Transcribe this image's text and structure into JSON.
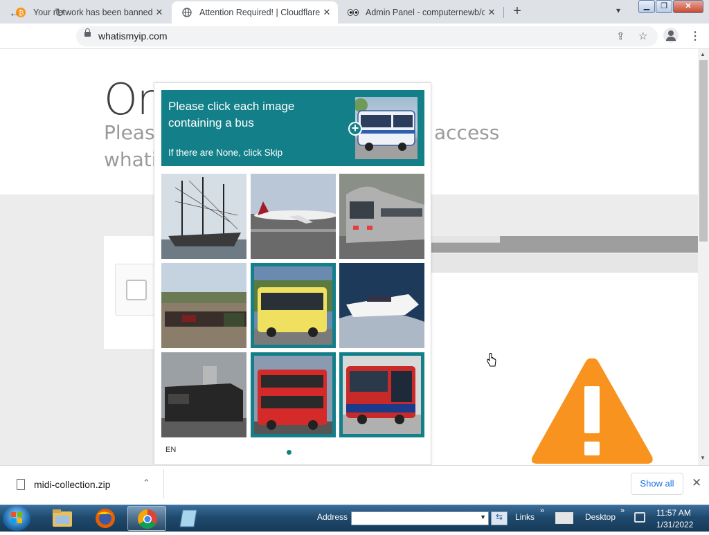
{
  "browser": {
    "tabs": [
      {
        "title": "Your network has been banned fr",
        "favicon": "bitcoin-icon",
        "active": false
      },
      {
        "title": "Attention Required! | Cloudflare",
        "favicon": "globe-icon",
        "active": true
      },
      {
        "title": "Admin Panel - computernewb/co",
        "favicon": "eyes-icon",
        "active": false
      }
    ],
    "new_tab": "+",
    "tab_dropdown": "⌄",
    "url": "whatismyip.com",
    "icons": [
      "back-icon",
      "forward-icon",
      "reload-icon",
      "lock-icon",
      "share-icon",
      "star-icon",
      "profile-icon",
      "menu-icon"
    ]
  },
  "page": {
    "heading": "On",
    "subtitle_left": "Please",
    "subtitle_right": "access",
    "subtitle_line2": "whatis"
  },
  "captcha": {
    "prompt_main": "Please click each image containing a bus",
    "prompt_sub": "If there are None, click Skip",
    "language": "EN",
    "accent": "#138089",
    "tiles": [
      {
        "subject": "ship",
        "selected": false
      },
      {
        "subject": "airplane",
        "selected": false
      },
      {
        "subject": "train",
        "selected": false
      },
      {
        "subject": "train",
        "selected": false
      },
      {
        "subject": "bus",
        "selected": true
      },
      {
        "subject": "boat",
        "selected": false
      },
      {
        "subject": "train",
        "selected": false
      },
      {
        "subject": "bus",
        "selected": true
      },
      {
        "subject": "bus",
        "selected": true
      }
    ]
  },
  "downloads": {
    "file": "midi-collection.zip",
    "chevron": "⌃",
    "show_all": "Show all",
    "close": "✕"
  },
  "taskbar": {
    "address_label": "Address",
    "links_label": "Links",
    "desktop_label": "Desktop",
    "time": "11:57 AM",
    "date": "1/31/2022",
    "chevrons": "»"
  },
  "colors": {
    "warning": "#f7931e",
    "teal": "#138089"
  }
}
